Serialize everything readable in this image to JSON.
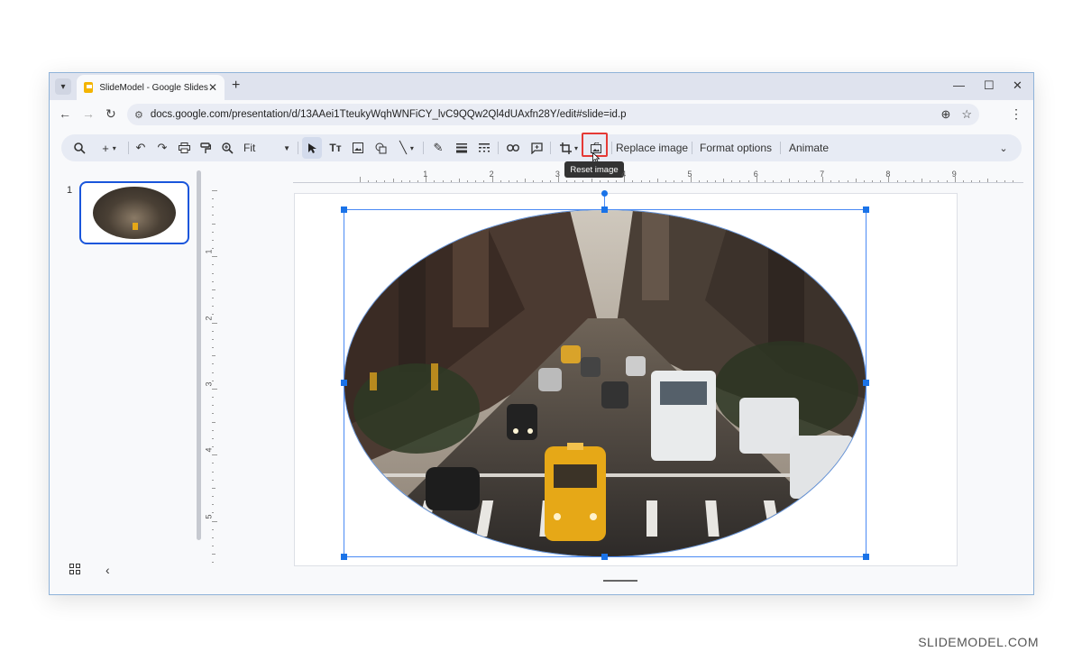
{
  "browser": {
    "tab_title": "SlideModel - Google Slides",
    "url": "docs.google.com/presentation/d/13AAei1TteukyWqhWNFiCY_lvC9QQw2Ql4dUAxfn28Y/edit#slide=id.p"
  },
  "toolbar": {
    "zoom_value": "Fit",
    "replace_image_label": "Replace image",
    "format_options_label": "Format options",
    "animate_label": "Animate",
    "tooltip": "Reset image"
  },
  "filmstrip": {
    "slide_number": "1"
  },
  "ruler": {
    "horizontal": [
      "1",
      "2",
      "3",
      "4",
      "5",
      "6",
      "7",
      "8",
      "9"
    ],
    "vertical": [
      "1",
      "2",
      "3",
      "4",
      "5"
    ]
  },
  "watermark": "SLIDEMODEL.COM",
  "colors": {
    "selection": "#1a73e8",
    "highlight": "#e53935",
    "accent": "#1a56db"
  }
}
